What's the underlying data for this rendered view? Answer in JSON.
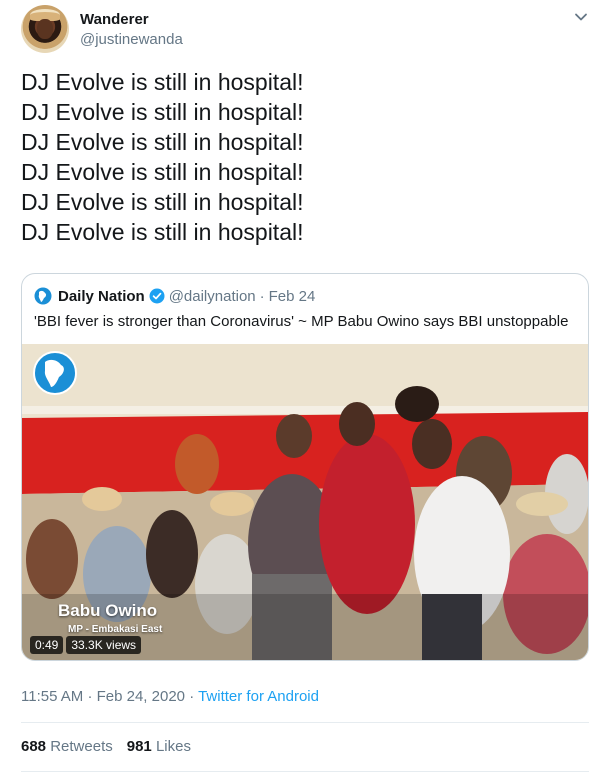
{
  "author": {
    "display_name": "Wanderer",
    "handle": "@justinewanda"
  },
  "tweet_lines": [
    "DJ Evolve is still in hospital!",
    "DJ Evolve is still in hospital!",
    "DJ Evolve is still in hospital!",
    "DJ Evolve is still in hospital!",
    "DJ Evolve is still in hospital!",
    "DJ Evolve is still in hospital!"
  ],
  "quote": {
    "name": "Daily Nation",
    "handle": "@dailynation",
    "separator": "·",
    "date": "Feb 24",
    "text": "'BBI fever is stronger than Coronavirus' ~ MP Babu Owino says BBI unstoppable",
    "video": {
      "caption_name": "Babu Owino",
      "caption_role": "MP - Embakasi East",
      "duration": "0:49",
      "views": "33.3K views"
    }
  },
  "meta": {
    "time": "11:55 AM",
    "separator": "·",
    "date": "Feb 24, 2020",
    "source": "Twitter for Android"
  },
  "stats": {
    "retweets_count": "688",
    "retweets_label": "Retweets",
    "likes_count": "981",
    "likes_label": "Likes"
  },
  "colors": {
    "accent": "#1da1f2",
    "text": "#14171a",
    "secondary": "#657786",
    "border": "#ccd6dd"
  },
  "icons": {
    "caret": "chevron-down-icon",
    "verified": "verified-badge-icon",
    "quote_logo": "daily-nation-logo-icon"
  }
}
